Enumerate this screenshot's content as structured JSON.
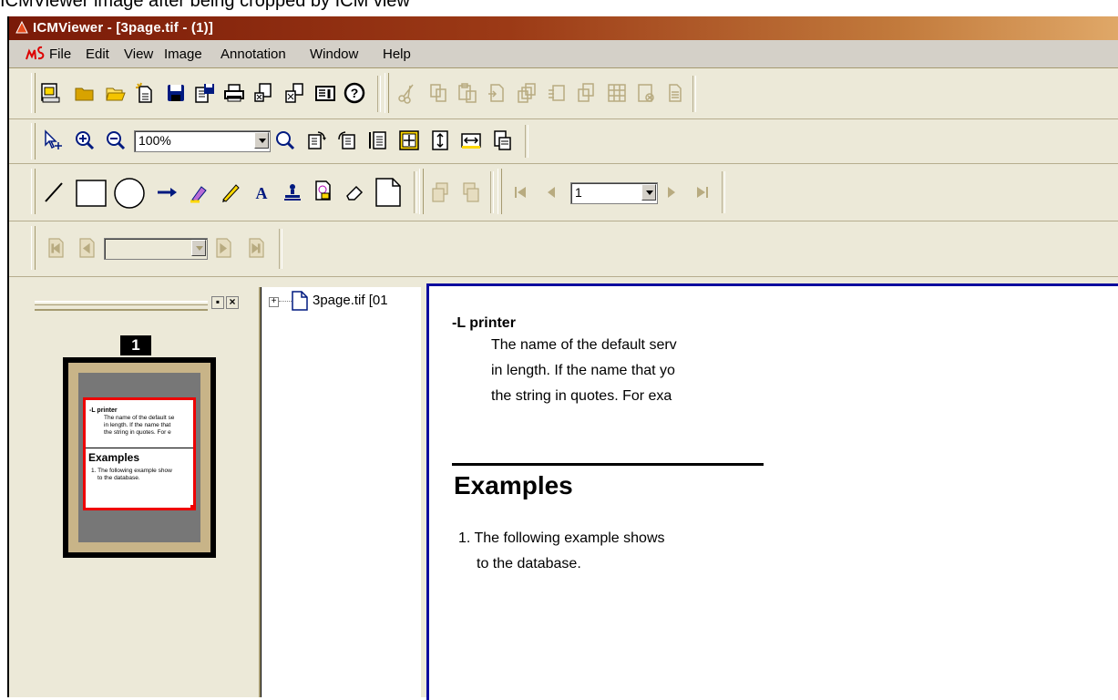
{
  "caption": "ICMViewer image after being cropped by ICM view",
  "window": {
    "title": "ICMViewer - [3page.tif - (1)]"
  },
  "menu": [
    "File",
    "Edit",
    "View",
    "Image",
    "Annotation",
    "Window",
    "Help"
  ],
  "toolbar": {
    "zoom_value": "100%",
    "page_value": "1"
  },
  "thumbnail_panel": {
    "page_badge": "1",
    "thumb_option": "-L printer",
    "thumb_desc_lines": [
      "The name of the default se",
      "in length. If the name that",
      "the string in quotes. For e"
    ],
    "thumb_heading": "Examples",
    "thumb_example_lines": [
      "1. The following example show",
      "to the database."
    ],
    "restore_glyph": "▪",
    "close_glyph": "×"
  },
  "tree": {
    "expander": "+",
    "file_label": "3page.tif [01"
  },
  "document": {
    "option": "-L printer",
    "description_lines": [
      "The name of the default serv",
      "in length. If the name that yo",
      "the string in quotes. For exa"
    ],
    "heading": "Examples",
    "example_lines": [
      "1. The following example shows",
      "to the database."
    ]
  },
  "colors": {
    "titlebar": "#9c3a16",
    "toolbar_bg": "#ece9d8",
    "viewer_border": "#0c0c9e",
    "thumb_selection": "#ee0000"
  }
}
